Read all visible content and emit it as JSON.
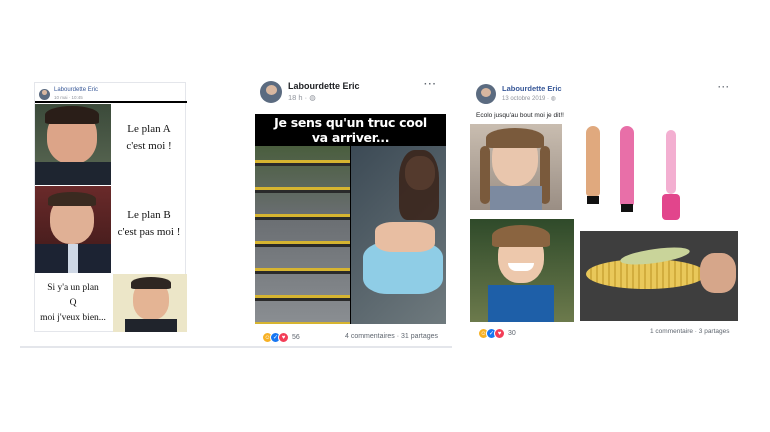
{
  "posts": [
    {
      "author": "Labourdette Eric",
      "time": "10 mai · 10:45",
      "panels": [
        "Le plan A\nc'est moi !",
        "Le plan B\nc'est pas moi !",
        "Si y'a un plan\nQ\nmoi j'veux bien..."
      ]
    },
    {
      "author": "Labourdette Eric",
      "time": "18 h ·",
      "meme_text": "Je sens qu'un truc cool\nva arriver...",
      "reaction_count": "56",
      "comments": "4 commentaires",
      "shares": "31 partages"
    },
    {
      "author": "Labourdette Eric",
      "time": "13 octobre 2019 ·",
      "text": "Ecolo jusqu'au bout moi je dit!!",
      "reaction_count": "30",
      "comments": "1 commentaire",
      "shares": "3 partages"
    }
  ],
  "colors": {
    "name": "#385898",
    "like": "#1877f2",
    "haha": "#f7b125",
    "love": "#f33e58"
  }
}
